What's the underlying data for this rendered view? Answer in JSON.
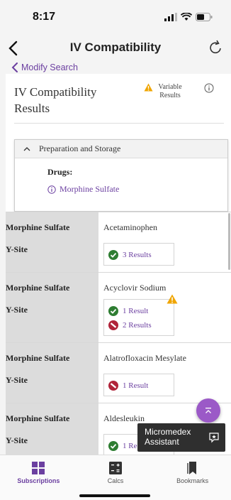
{
  "status": {
    "time": "8:17"
  },
  "nav": {
    "title": "IV Compatibility"
  },
  "modify_search": "Modify Search",
  "results": {
    "title": "IV Compatibility Results",
    "variable_label": "Variable Results"
  },
  "prep": {
    "header": "Preparation and Storage",
    "drugs_label": "Drugs:",
    "drug_link": "Morphine Sulfate"
  },
  "rows": [
    {
      "drug": "Morphine Sulfate",
      "method": "Y-Site",
      "other_drug": "Acetaminophen",
      "results": [
        {
          "status": "compatible",
          "label": "3 Results"
        }
      ]
    },
    {
      "drug": "Morphine Sulfate",
      "method": "Y-Site",
      "other_drug": "Acyclovir Sodium",
      "results": [
        {
          "status": "compatible",
          "label": "1 Result"
        },
        {
          "status": "incompatible",
          "label": "2 Results"
        }
      ]
    },
    {
      "drug": "Morphine Sulfate",
      "method": "Y-Site",
      "other_drug": "Alatrofloxacin Mesylate",
      "results": [
        {
          "status": "incompatible",
          "label": "1 Result"
        }
      ]
    },
    {
      "drug": "Morphine Sulfate",
      "method": "Y-Site",
      "other_drug": "Aldesleukin",
      "results": [
        {
          "status": "compatible",
          "label": "1 Re"
        }
      ]
    }
  ],
  "assistant": {
    "line1": "Micromedex",
    "line2": "Assistant"
  },
  "tabs": [
    {
      "label": "Subscriptions",
      "icon": "grid-icon",
      "active": true
    },
    {
      "label": "Calcs",
      "icon": "calculator-icon",
      "active": false
    },
    {
      "label": "Bookmarks",
      "icon": "bookmark-icon",
      "active": false
    }
  ],
  "colors": {
    "accent": "#6b3fa0",
    "compatible": "#2e7d32",
    "incompatible": "#b0243a",
    "warning": "#f0a500"
  }
}
